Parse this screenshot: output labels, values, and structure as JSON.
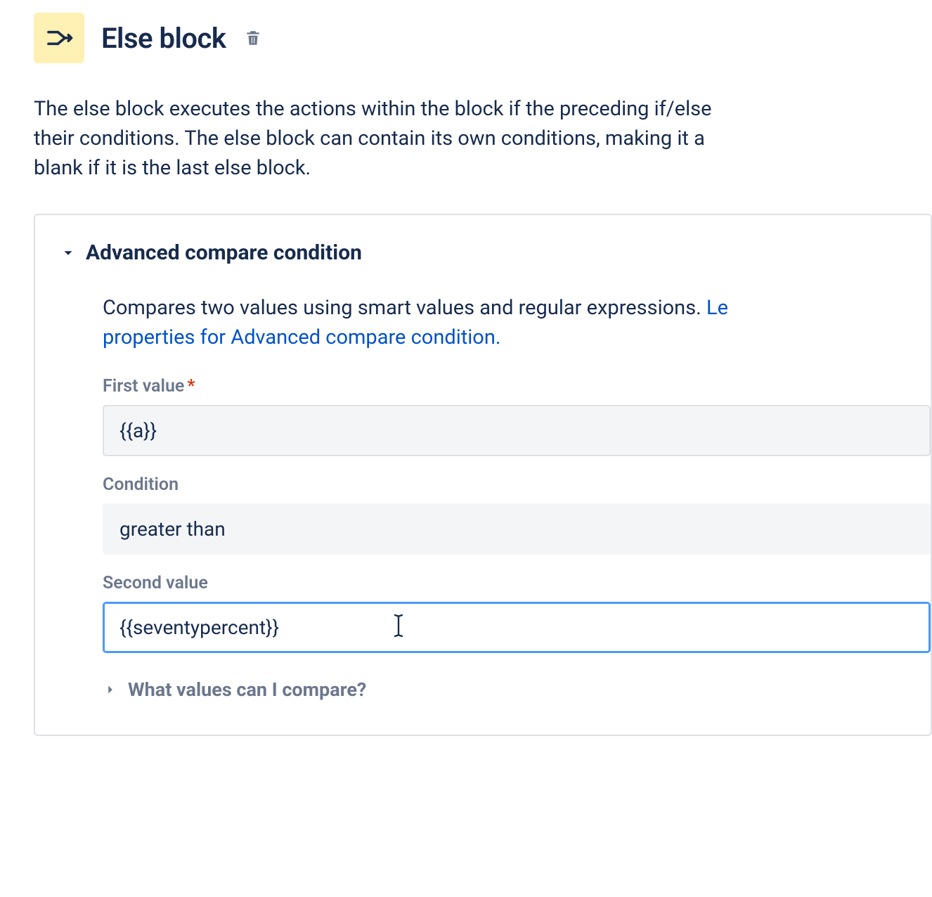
{
  "header": {
    "title": "Else block"
  },
  "description": {
    "line1": "The else block executes the actions within the block if the preceding if/else",
    "line2": "their conditions. The else block can contain its own conditions, making it a",
    "line3": "blank if it is the last else block."
  },
  "section": {
    "title": "Advanced compare condition",
    "desc_pre": "Compares two values using smart values and regular expressions. ",
    "link_1": "Le",
    "link_2": "properties for Advanced compare condition."
  },
  "fields": {
    "first_value": {
      "label": "First value",
      "required_marker": "*",
      "value": "{{a}}"
    },
    "condition": {
      "label": "Condition",
      "value": "greater than"
    },
    "second_value": {
      "label": "Second value",
      "value": "{{seventypercent}}"
    }
  },
  "expander": {
    "label": "What values can I compare?"
  }
}
